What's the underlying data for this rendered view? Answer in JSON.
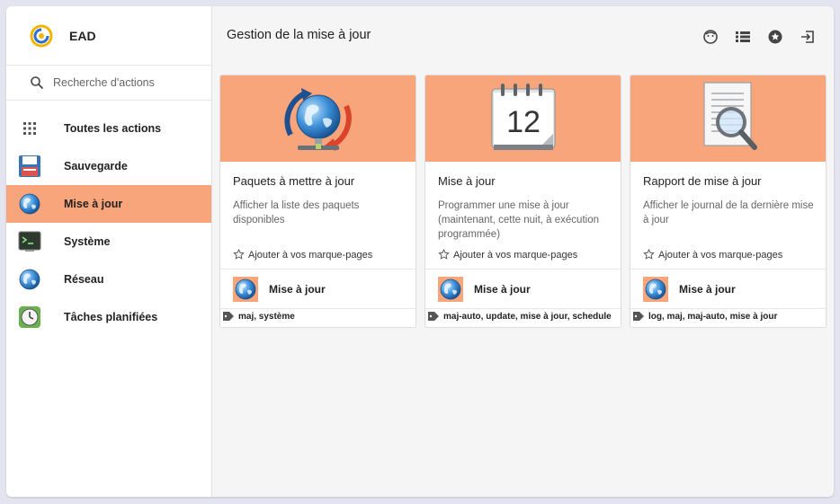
{
  "app": {
    "name": "EAD"
  },
  "search": {
    "placeholder": "Recherche d'actions"
  },
  "sidebar": {
    "items": [
      {
        "label": "Toutes les actions",
        "icon": "grid-icon",
        "active": false
      },
      {
        "label": "Sauvegarde",
        "icon": "floppy-disk-icon",
        "active": false
      },
      {
        "label": "Mise à jour",
        "icon": "globe-icon",
        "active": true
      },
      {
        "label": "Système",
        "icon": "terminal-icon",
        "active": false
      },
      {
        "label": "Réseau",
        "icon": "globe-icon",
        "active": false
      },
      {
        "label": "Tâches planifiées",
        "icon": "clock-icon",
        "active": false
      }
    ]
  },
  "header": {
    "title": "Gestion de la mise à jour",
    "icons": [
      "face-icon",
      "list-icon",
      "star-circle-icon",
      "logout-icon"
    ]
  },
  "cards": [
    {
      "title": "Paquets à mettre à jour",
      "description": "Afficher la liste des paquets disponibles",
      "bookmark": "Ajouter à vos marque-pages",
      "category": "Mise à jour",
      "tags": "maj, système",
      "banner_icon": "globe-network-icon"
    },
    {
      "title": "Mise à jour",
      "description": "Programmer une mise à jour (maintenant, cette nuit, à exécution programmée)",
      "bookmark": "Ajouter à vos marque-pages",
      "category": "Mise à jour",
      "tags": "maj-auto, update, mise à jour, schedule",
      "banner_icon": "calendar-icon",
      "calendar_day": "12"
    },
    {
      "title": "Rapport de mise à jour",
      "description": "Afficher le journal de la dernière mise à jour",
      "bookmark": "Ajouter à vos marque-pages",
      "category": "Mise à jour",
      "tags": "log, maj, maj-auto, mise à jour",
      "banner_icon": "document-search-icon"
    }
  ],
  "colors": {
    "accent": "#f8a57b",
    "background": "#f5f5f5",
    "page": "#e3e4f0"
  }
}
